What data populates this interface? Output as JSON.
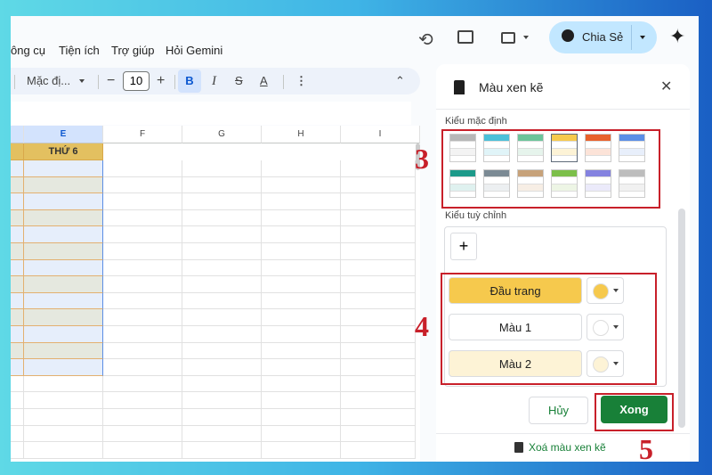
{
  "menu": [
    "ông cụ",
    "Tiện ích",
    "Trợ giúp",
    "Hỏi Gemini"
  ],
  "header": {
    "share_label": "Chia Sẻ"
  },
  "toolbar": {
    "font": "Mặc đị...",
    "font_size": "10",
    "bold": "B",
    "italic": "I",
    "strike": "S",
    "text_color": "A"
  },
  "sheet": {
    "columns": [
      "E",
      "F",
      "G",
      "H",
      "I"
    ],
    "header_cell": "THỨ 6"
  },
  "panel": {
    "title": "Màu xen kẽ",
    "default_label": "Kiểu mặc định",
    "custom_label": "Kiểu tuỳ chỉnh",
    "add": "+",
    "presets": [
      [
        "#b7b7b7",
        "#f3f3f3"
      ],
      [
        "#4bc0d9",
        "#e0f4f8"
      ],
      [
        "#6cc49a",
        "#e6f4ec"
      ],
      [
        "#f6c94d",
        "#fdf3d6"
      ],
      [
        "#e8612c",
        "#fce3d8"
      ],
      [
        "#5b8ee6",
        "#e8effb"
      ],
      [
        "#1c9a8a",
        "#dff1ef"
      ],
      [
        "#7b8a94",
        "#eceff1"
      ],
      [
        "#c7a27a",
        "#f7eee5"
      ],
      [
        "#7cbf4a",
        "#edf5e5"
      ],
      [
        "#8482e0",
        "#ebeafa"
      ],
      [
        "#bdbdbd",
        "#f1f1f1"
      ]
    ],
    "rows": [
      {
        "label": "Đầu trang",
        "color": "#f6c94d"
      },
      {
        "label": "Màu 1",
        "color": "#ffffff"
      },
      {
        "label": "Màu 2",
        "color": "#fdf3d6"
      }
    ],
    "cancel": "Hủy",
    "done": "Xong",
    "remove": "Xoá màu xen kẽ"
  },
  "annotations": [
    "3",
    "4",
    "5"
  ]
}
